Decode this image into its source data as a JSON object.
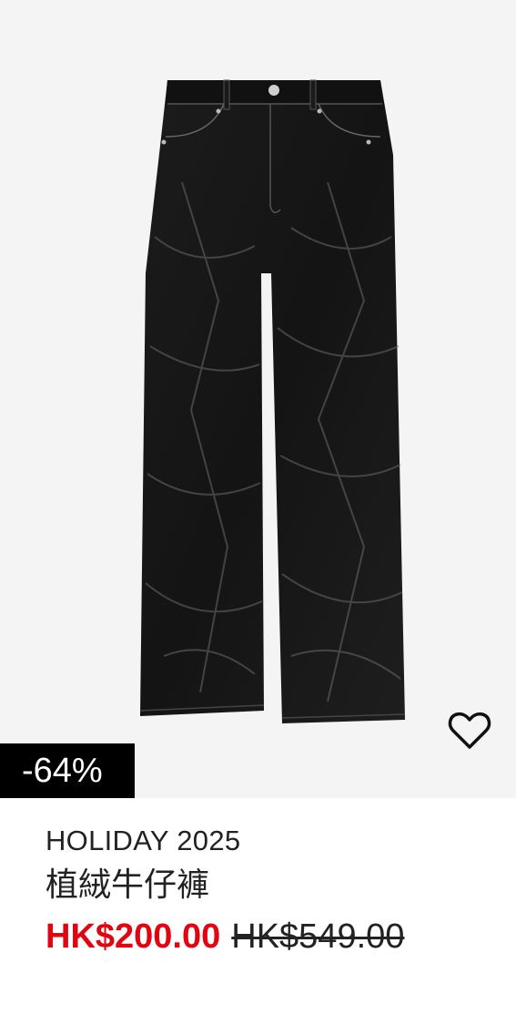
{
  "product": {
    "badge": "-64%",
    "brand": "HOLIDAY 2025",
    "title": "植絨牛仔褲",
    "sale_price": "HK$200.00",
    "original_price": "HK$549.00",
    "image_icon": "jeans-image",
    "favorite_icon": "heart-outline-icon"
  },
  "colors": {
    "sale": "#e00510",
    "badge_bg": "#000000",
    "image_bg": "#f4f4f4"
  }
}
